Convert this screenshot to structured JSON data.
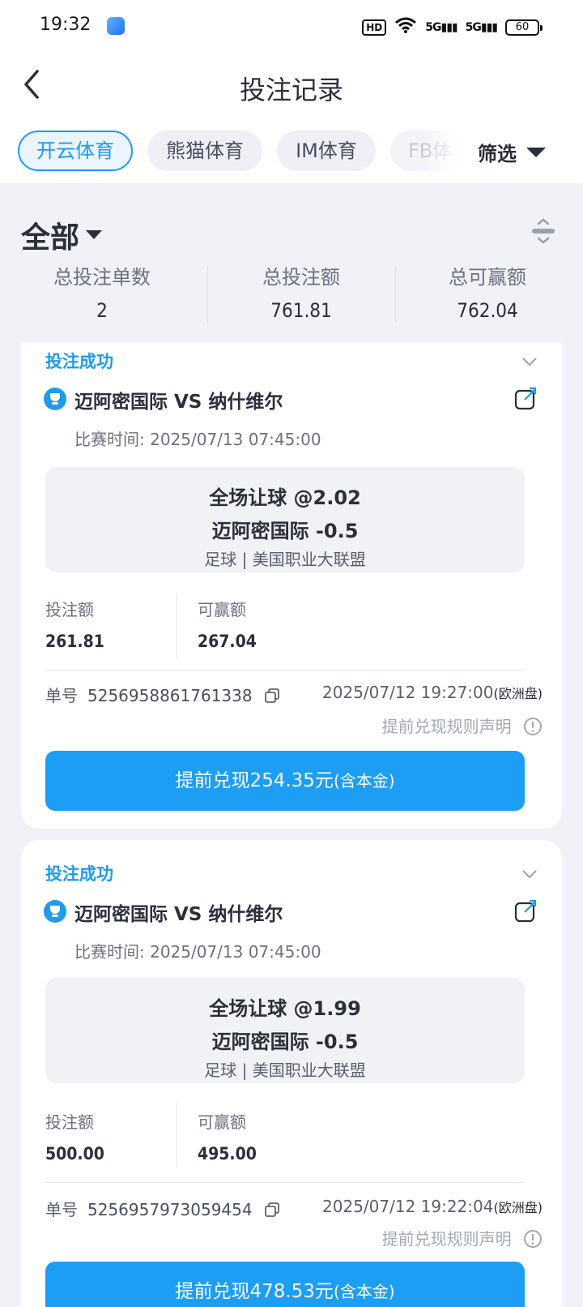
{
  "status_bar": {
    "time": "19:32",
    "hd": "HD",
    "signal1": "5G",
    "signal2": "5G",
    "battery": "60"
  },
  "header": {
    "title": "投注记录"
  },
  "tabs": [
    {
      "label": "开云体育"
    },
    {
      "label": "熊猫体育"
    },
    {
      "label": "IM体育"
    },
    {
      "label": "FB体"
    }
  ],
  "filter": {
    "label": "筛选"
  },
  "summary": {
    "scope_label": "全部",
    "stats": [
      {
        "label": "总投注单数",
        "value": "2"
      },
      {
        "label": "总投注额",
        "value": "761.81"
      },
      {
        "label": "总可赢额",
        "value": "762.04"
      }
    ]
  },
  "bets": [
    {
      "status": "投注成功",
      "match": "迈阿密国际 VS 纳什维尔",
      "match_time": "比赛时间: 2025/07/13 07:45:00",
      "market": "全场让球 @2.02",
      "selection": "迈阿密国际  -0.5",
      "league": "足球 | 美国职业大联盟",
      "stake_label": "投注额",
      "stake": "261.81",
      "win_label": "可赢额",
      "win": "267.04",
      "order_label": "单号",
      "order_no": "5256958861761338",
      "bet_time": "2025/07/12 19:27:00",
      "odds_type": "(欧洲盘)",
      "rule_text": "提前兑现规则声明",
      "cashout_text": "提前兑现254.35元",
      "cashout_suffix": "(含本金)"
    },
    {
      "status": "投注成功",
      "match": "迈阿密国际 VS 纳什维尔",
      "match_time": "比赛时间: 2025/07/13 07:45:00",
      "market": "全场让球 @1.99",
      "selection": "迈阿密国际  -0.5",
      "league": "足球 | 美国职业大联盟",
      "stake_label": "投注额",
      "stake": "500.00",
      "win_label": "可赢额",
      "win": "495.00",
      "order_label": "单号",
      "order_no": "5256957973059454",
      "bet_time": "2025/07/12 19:22:04",
      "odds_type": "(欧洲盘)",
      "rule_text": "提前兑现规则声明",
      "cashout_text": "提前兑现478.53元",
      "cashout_suffix": "(含本金)"
    }
  ],
  "colors": {
    "accent": "#1d9bf0",
    "button": "#1c9ef5",
    "background": "#f0f2f7"
  }
}
